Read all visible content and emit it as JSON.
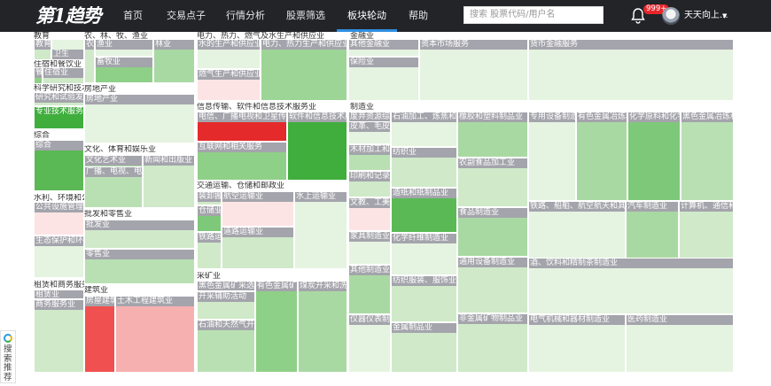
{
  "nav": {
    "logo": "第1趋势",
    "links": [
      "首页",
      "交易点子",
      "行情分析",
      "股票筛选",
      "板块轮动",
      "帮助"
    ],
    "active_index": 4,
    "search_placeholder": "搜索 股票代码/用户名",
    "notification_count": "999+",
    "username": "天天向上...",
    "caret": "▼"
  },
  "colors": {
    "nav_bg": "#222428",
    "accent": "#2f8fe0",
    "label_bg": "#a4a4ac",
    "strong_green": "#3da83d",
    "mid_green": "#7ec87a",
    "light_green": "#cfe9c9",
    "pale_green": "#e5f3e1",
    "strong_red": "#e42a2a",
    "light_red": "#f8c5c5",
    "pale_red": "#fde4e4"
  },
  "sections": {
    "s1": "教育",
    "s2": "农、林、牧、渔业",
    "s3": "电力、热力、燃气及水生产和供应业",
    "s4": "金融业",
    "s5": "住宿和餐饮业",
    "s6": "科学研究和技术服务业",
    "s7": "房地产业",
    "s8": "综合",
    "s9": "文化、体育和娱乐业",
    "s10": "信息传输、软件和信息技术服务业",
    "s11": "制造业",
    "s12": "水利、环境和公共设施管理业",
    "s13": "交通运输、仓储和邮政业",
    "s14": "批发和零售业",
    "s15": "租赁和商务服务业",
    "s16": "建筑业",
    "s17": "采矿业"
  },
  "subs": {
    "edu1": "教育",
    "edu2": "卫生",
    "agr1": "农业",
    "agr2": "渔业",
    "agr3": "林业",
    "agr4": "畜牧业",
    "pwr1": "水的生产和供应业",
    "pwr2": "电力、热力生产和供应业",
    "pwr3": "燃气生产和供应业",
    "fin1": "其他金融业",
    "fin2": "资本市场服务",
    "fin3": "货币金融服务",
    "fin4": "保险业",
    "hot1": "餐饮业",
    "hot2": "住宿业",
    "sci1": "研究和试验发展",
    "sci2": "专业技术服务业",
    "re1": "房地产业",
    "cmp1": "综合",
    "cul1": "文化艺术业",
    "cul2": "新闻和出版业",
    "cul3": "广播、电视、电影和影视录音制作业",
    "it1": "电信、广播电视和卫星传输服务",
    "it2": "软件和信息技术服务业",
    "it3": "互联网和相关服务",
    "mf1": "废弃资源综合利用业",
    "mf2": "石油加工、炼焦和核燃料加工业",
    "mf3": "橡胶和塑料制品业",
    "mf4": "专用设备制造业",
    "mf5": "有色金属冶炼和压延加工业",
    "mf6": "化学原料和化学制品制造业",
    "mf7": "黑色金属冶炼和压延加工业",
    "mf8": "皮革、毛皮、羽毛及其制品和制鞋业",
    "mf9": "木材加工和木、竹、藤、棕、草制品业",
    "mf10": "纺织业",
    "mf11": "农副食品加工业",
    "mf12": "印刷和记录媒介复制业",
    "mf13": "造纸和纸制品业",
    "mf14": "食品制造业",
    "mf15": "铁路、船舶、航空航天和其他运输设备制造业",
    "mf16": "汽车制造业",
    "mf17": "计算机、通信和其他电子设备制造业",
    "mf18": "文教、工美、体育和娱乐用品制造业",
    "mf19": "家具制造业",
    "mf20": "化学纤维制造业",
    "mf21": "通用设备制造业",
    "mf22": "酒、饮料和精制茶制造业",
    "mf23": "其他制造业",
    "mf24": "纺织服装、服饰业",
    "mf25": "非金属矿物制品业",
    "mf26": "电气机械和器材制造业",
    "mf27": "医药制造业",
    "mf28": "仪器仪表制造业",
    "mf29": "金属制品业",
    "wat1": "公共设施管理业",
    "wat2": "生态保护和环境治理业",
    "tr1": "装卸搬运和运输代理业",
    "tr2": "航空运输业",
    "tr3": "水上运输业",
    "tr4": "仓储业",
    "tr5": "铁路运输业",
    "tr6": "道路运输业",
    "ws1": "批发业",
    "ws2": "零售业",
    "rnt1": "租赁业",
    "rnt2": "商务服务业",
    "bld1": "房屋建筑业",
    "bld2": "土木工程建筑业",
    "min1": "黑色金属矿采选业",
    "min2": "有色金属矿采选业",
    "min3": "煤炭开采和洗选业",
    "min4": "开采辅助活动",
    "min5": "石油和天然气开采业"
  },
  "side_widget": {
    "label": "搜索推荐"
  }
}
